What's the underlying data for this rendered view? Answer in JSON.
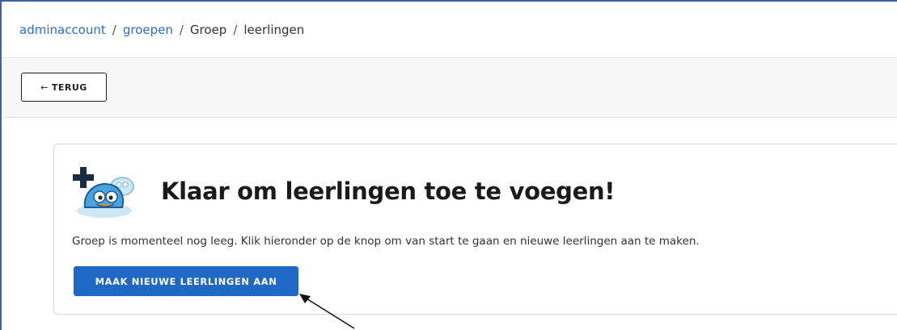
{
  "breadcrumb": {
    "items": [
      {
        "label": "adminaccount",
        "link": true
      },
      {
        "label": "groepen",
        "link": true
      },
      {
        "label": "Groep",
        "link": false
      },
      {
        "label": "leerlingen",
        "link": false
      }
    ],
    "separator": "/"
  },
  "toolbar": {
    "back_arrow": "←",
    "back_label": "TERUG"
  },
  "empty_state": {
    "icon": "mascot-add-icon",
    "title": "Klaar om leerlingen toe te voegen!",
    "description": "Groep is momenteel nog leeg. Klik hieronder op de knop om van start te gaan en nieuwe leerlingen aan te maken.",
    "cta_label": "MAAK NIEUWE LEERLINGEN AAN"
  },
  "colors": {
    "link": "#2a6fc9",
    "primary": "#1f68c3",
    "frame": "#3c63a4"
  }
}
